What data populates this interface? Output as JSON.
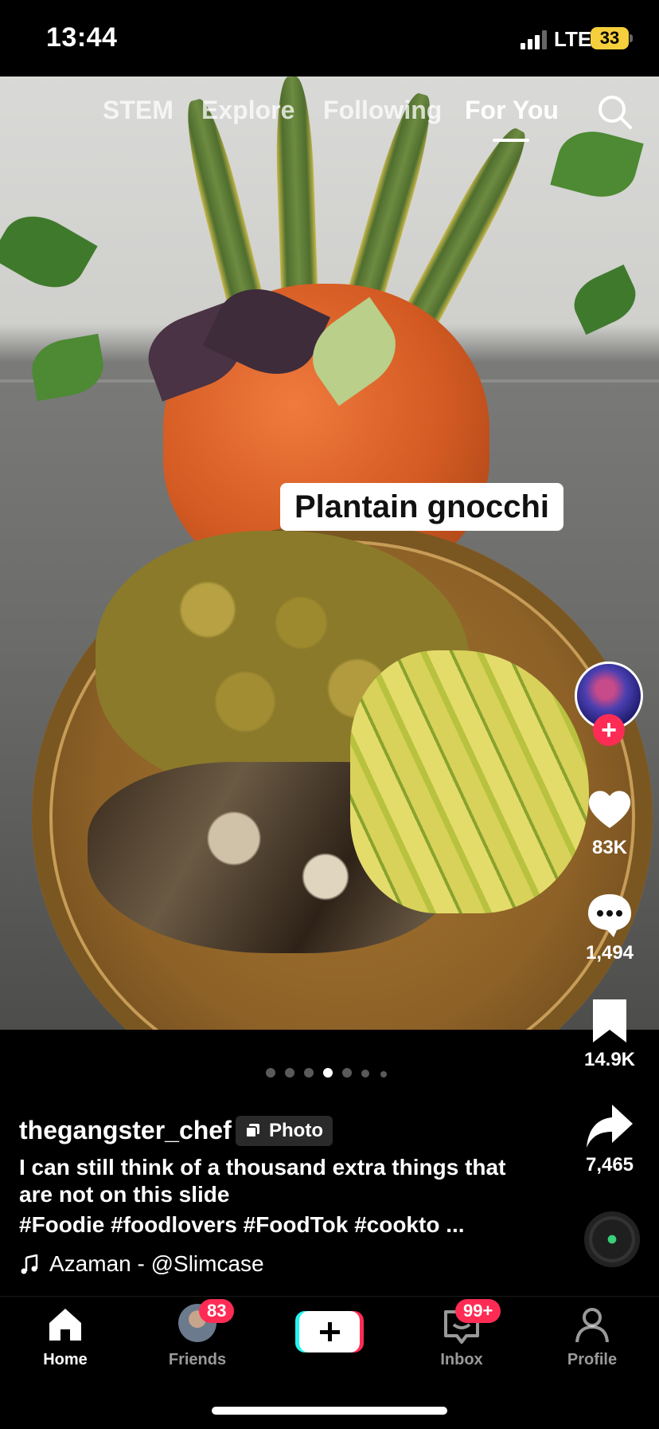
{
  "status_bar": {
    "time": "13:44",
    "network": "LTE",
    "battery": "33",
    "battery_color": "#f5cf3c"
  },
  "top_tabs": {
    "items": [
      {
        "label": "STEM",
        "active": false
      },
      {
        "label": "Explore",
        "active": false
      },
      {
        "label": "Following",
        "active": false
      },
      {
        "label": "For You",
        "active": true
      }
    ],
    "search_icon": "search-icon"
  },
  "post": {
    "image_caption": "Plantain gnocchi",
    "carousel": {
      "total": 7,
      "current": 4
    },
    "username": "thegangster_chef",
    "type_badge": "Photo",
    "description": "I can still think of a thousand extra things that are not on this slide",
    "hashtags": "#Foodie #foodlovers #FoodTok #cookto ...",
    "sound": "Azaman - @Slimcase"
  },
  "actions": {
    "likes": "83K",
    "comments": "1,494",
    "saves": "14.9K",
    "shares": "7,465",
    "follow_symbol": "+"
  },
  "bottom_nav": {
    "items": [
      {
        "label": "Home",
        "active": true
      },
      {
        "label": "Friends",
        "badge": "83"
      },
      {
        "label": "Create"
      },
      {
        "label": "Inbox",
        "badge": "99+"
      },
      {
        "label": "Profile"
      }
    ]
  },
  "colors": {
    "accent": "#fe2c55",
    "create_cyan": "#25f4ee"
  }
}
